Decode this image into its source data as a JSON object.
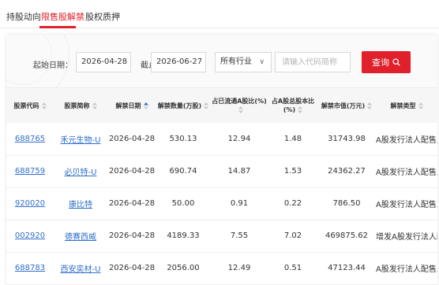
{
  "tabs": [
    {
      "label": "持股动向"
    },
    {
      "label": "限售股解禁"
    },
    {
      "label": "股权质押"
    }
  ],
  "filters": {
    "start_label": "起始日期：",
    "start_value": "2026-04-28",
    "end_label": "截止日期：",
    "end_value": "2026-06-27",
    "industry_value": "所有行业",
    "search_placeholder": "请输入代码简称",
    "query_label": "查询"
  },
  "columns": [
    {
      "label": "股票代码"
    },
    {
      "label": "股票简称"
    },
    {
      "label": "解禁日期"
    },
    {
      "label": "解禁数量(万股)"
    },
    {
      "label": "占已流通A股比(%)"
    },
    {
      "label": "占A股总股本比(%)"
    },
    {
      "label": "解禁市值(万元)"
    },
    {
      "label": "解禁类型"
    }
  ],
  "rows": [
    {
      "code": "688765",
      "name": "禾元生物-U",
      "date": "2026-04-28",
      "qty": "530.13",
      "float_pct": "12.94",
      "total_pct": "1.48",
      "value": "31743.98",
      "type": "A股发行法人配售上市"
    },
    {
      "code": "688759",
      "name": "必贝特-U",
      "date": "2026-04-28",
      "qty": "690.74",
      "float_pct": "14.87",
      "total_pct": "1.53",
      "value": "24362.27",
      "type": "A股发行法人配售上市"
    },
    {
      "code": "920020",
      "name": "康比特",
      "date": "2026-04-28",
      "qty": "50.00",
      "float_pct": "0.91",
      "total_pct": "0.22",
      "value": "786.50",
      "type": "A股发行法人配售上市"
    },
    {
      "code": "002920",
      "name": "德赛西威",
      "date": "2026-04-28",
      "qty": "4189.33",
      "float_pct": "7.55",
      "total_pct": "7.02",
      "value": "469875.62",
      "type": "增发A股发行法人配售上市"
    },
    {
      "code": "688783",
      "name": "西安奕材-U",
      "date": "2026-04-28",
      "qty": "2056.00",
      "float_pct": "12.49",
      "total_pct": "0.51",
      "value": "47123.44",
      "type": "A股发行法人配售上市"
    }
  ],
  "colors": {
    "accent": "#e0202a",
    "link": "#2f6fc9"
  },
  "icons": {
    "query": "search-icon",
    "sort": "sort-icon",
    "dropdown": "chevron-down-icon"
  }
}
